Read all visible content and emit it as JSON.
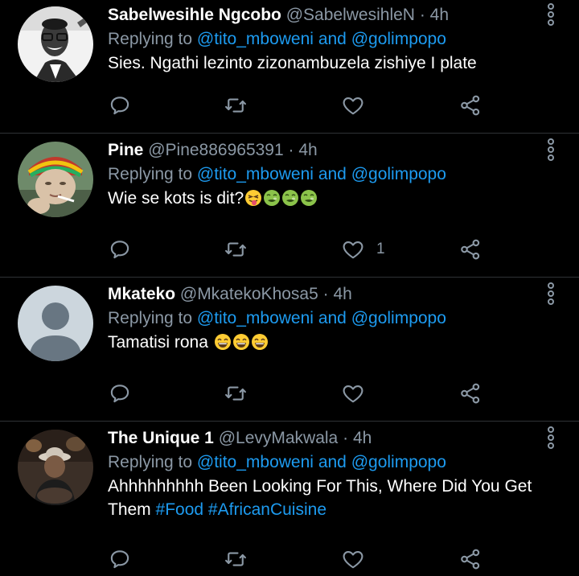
{
  "colors": {
    "background": "#000000",
    "text": "#ffffff",
    "secondary": "#8b98a5",
    "link": "#1d9bf0",
    "divider": "#2f3336"
  },
  "icons": {
    "more": "vertical-dots-icon",
    "reply": "comment-icon",
    "retweet": "retweet-icon",
    "like": "heart-icon",
    "share": "share-icon"
  },
  "tweets": [
    {
      "name": "Sabelwesihle Ngcobo",
      "handle": "@SabelwesihleN",
      "dot": "·",
      "time": "4h",
      "replying_prefix": "Replying to",
      "mention1": "@tito_mboweni",
      "and": "and",
      "mention2": "@golimpopo",
      "text": "Sies. Ngathi lezinto zizonambuzela zishiye I plate",
      "like_count": ""
    },
    {
      "name": "Pine",
      "handle": "@Pine886965391",
      "dot": "·",
      "time": "4h",
      "replying_prefix": "Replying to",
      "mention1": "@tito_mboweni",
      "and": "and",
      "mention2": "@golimpopo",
      "text": "Wie se kots is dit?",
      "emojis": [
        "tongue-out-emoji",
        "nauseated-emoji",
        "nauseated-emoji",
        "nauseated-emoji"
      ],
      "like_count": "1"
    },
    {
      "name": "Mkateko",
      "handle": "@MkatekoKhosa5",
      "dot": "·",
      "time": "4h",
      "replying_prefix": "Replying to",
      "mention1": "@tito_mboweni",
      "and": "and",
      "mention2": "@golimpopo",
      "text": "Tamatisi rona",
      "emojis": [
        "laughing-emoji",
        "laughing-emoji",
        "laughing-emoji"
      ],
      "like_count": ""
    },
    {
      "name": "The Unique 1",
      "handle": "@LevyMakwala",
      "dot": "·",
      "time": "4h",
      "replying_prefix": "Replying to",
      "mention1": "@tito_mboweni",
      "and": "and",
      "mention2": "@golimpopo",
      "text": "Ahhhhhhhhh Been Looking For This, Where Did You Get Them",
      "hashtag1": "#Food",
      "hashtag2": "#AfricanCuisine",
      "like_count": ""
    }
  ]
}
